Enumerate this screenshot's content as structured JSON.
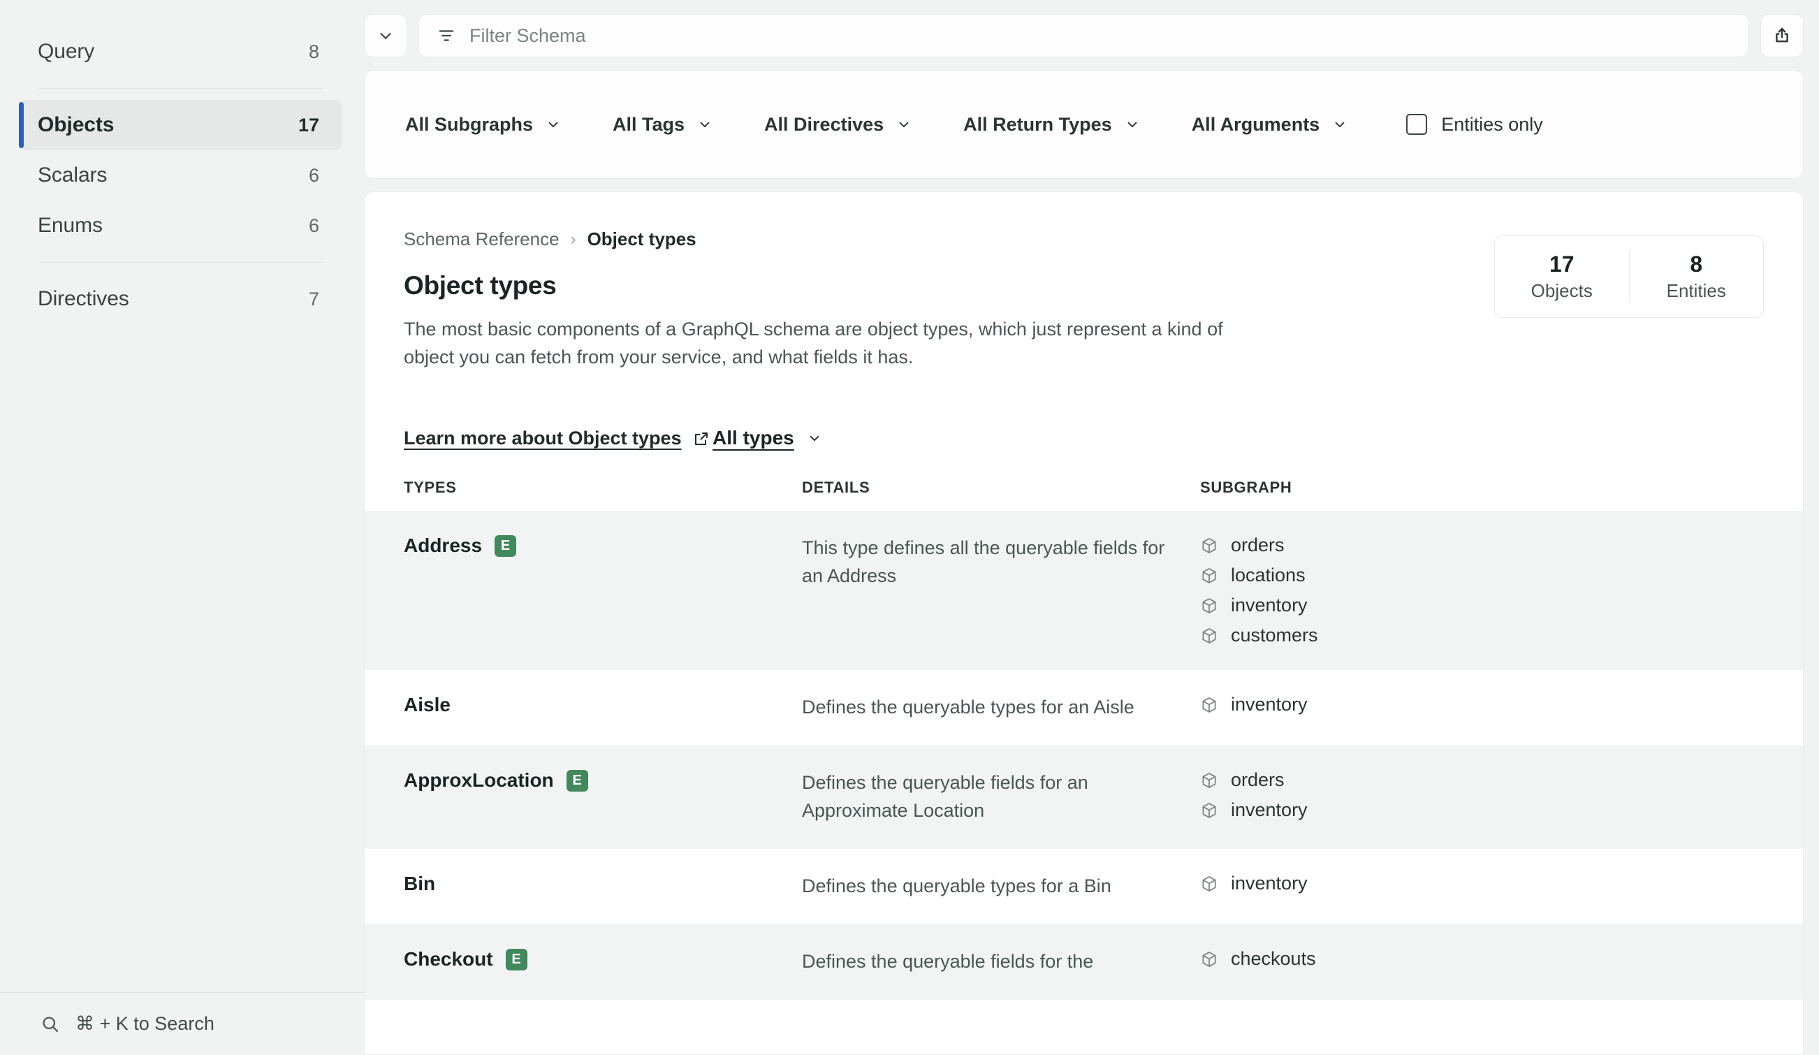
{
  "sidebar": {
    "items": [
      {
        "label": "Query",
        "count": "8",
        "active": false
      },
      {
        "label": "Objects",
        "count": "17",
        "active": true
      },
      {
        "label": "Scalars",
        "count": "6",
        "active": false
      },
      {
        "label": "Enums",
        "count": "6",
        "active": false
      },
      {
        "label": "Directives",
        "count": "7",
        "active": false
      }
    ],
    "search_hint": "⌘ + K to Search"
  },
  "topbar": {
    "collapse_icon": "chevron-down-icon",
    "filter_icon": "filter-icon",
    "filter_placeholder": "Filter Schema",
    "filter_value": "",
    "share_icon": "share-export-icon"
  },
  "facets": {
    "dropdowns": [
      {
        "label": "All Subgraphs"
      },
      {
        "label": "All Tags"
      },
      {
        "label": "All Directives"
      },
      {
        "label": "All Return Types"
      },
      {
        "label": "All Arguments"
      }
    ],
    "entities_only": {
      "label": "Entities only",
      "checked": false
    }
  },
  "content": {
    "breadcrumb": {
      "root": "Schema Reference",
      "separator": "›",
      "current": "Object types"
    },
    "title": "Object types",
    "description": "The most basic components of a GraphQL schema are object types, which just represent a kind of object you can fetch from your service, and what fields it has.",
    "learn_more": "Learn more about Object types",
    "stats": [
      {
        "value": "17",
        "label": "Objects"
      },
      {
        "value": "8",
        "label": "Entities"
      }
    ],
    "type_filter": "All types",
    "table": {
      "headers": {
        "types": "TYPES",
        "details": "DETAILS",
        "subgraph": "SUBGRAPH"
      },
      "rows": [
        {
          "type": "Address",
          "entity_badge": "E",
          "details": "This type defines all the queryable fields for an Address",
          "subgraphs": [
            "orders",
            "locations",
            "inventory",
            "customers"
          ]
        },
        {
          "type": "Aisle",
          "entity_badge": "",
          "details": "Defines the queryable types for an Aisle",
          "subgraphs": [
            "inventory"
          ]
        },
        {
          "type": "ApproxLocation",
          "entity_badge": "E",
          "details": "Defines the queryable fields for an Approximate Location",
          "subgraphs": [
            "orders",
            "inventory"
          ]
        },
        {
          "type": "Bin",
          "entity_badge": "",
          "details": "Defines the queryable types for a Bin",
          "subgraphs": [
            "inventory"
          ]
        },
        {
          "type": "Checkout",
          "entity_badge": "E",
          "details": "Defines the queryable fields for the",
          "subgraphs": [
            "checkouts"
          ]
        }
      ]
    }
  },
  "colors": {
    "accent_blue": "#2f5fb5",
    "entity_green": "#41885c",
    "page_bg": "#f1f3f2",
    "row_alt": "#f2f4f3"
  }
}
